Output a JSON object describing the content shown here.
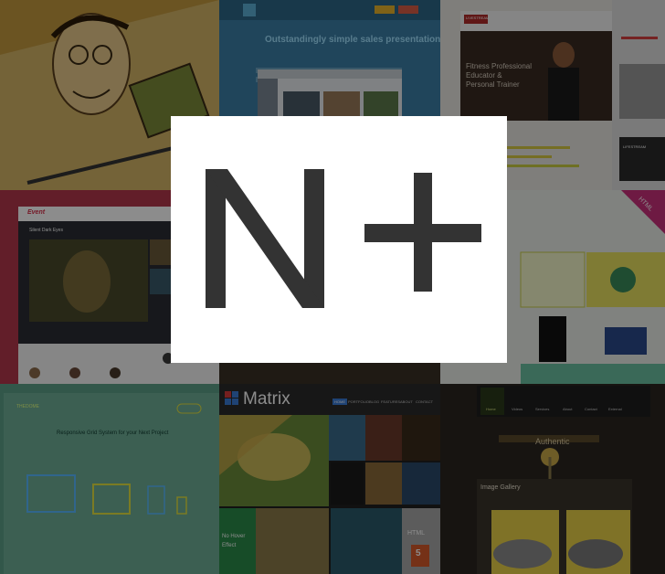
{
  "logo": {
    "text": "N+",
    "color": "#333333",
    "background": "#ffffff"
  },
  "tiles": {
    "sketch": {
      "bg": "#c8a24a"
    },
    "sales": {
      "headline": "Outstandingly simple sales presentations",
      "bg": "#3b7fa6"
    },
    "fitness": {
      "line1": "Fitness Professional",
      "line2": "Educator &",
      "line3": "Personal Trainer",
      "logo": "LIVESTREAM"
    },
    "sidebar_strip": {
      "label": "LIFESTREAM"
    },
    "video": {
      "title": "Silent Dark Eyes",
      "brand": "Event",
      "bg": "#b2384c"
    },
    "html_ribbon": {
      "label": "HTML"
    },
    "grid": {
      "brand": "THEDOME",
      "headline": "Responsive Grid System for your Next Project",
      "bg": "#5c9e87"
    },
    "matrix": {
      "title": "Matrix",
      "nav": [
        "HOME",
        "PORTFOLIO",
        "BLOG",
        "FEATURES",
        "ABOUT",
        "CONTACT"
      ],
      "hover_label": "No Hover Effect",
      "html_badge": "HTML",
      "html_badge_num": "5"
    },
    "authentic": {
      "nav": [
        "Home",
        "Videos",
        "Services",
        "About",
        "Contact",
        "External"
      ],
      "hero": "Authentic",
      "gallery_title": "Image Gallery"
    }
  }
}
